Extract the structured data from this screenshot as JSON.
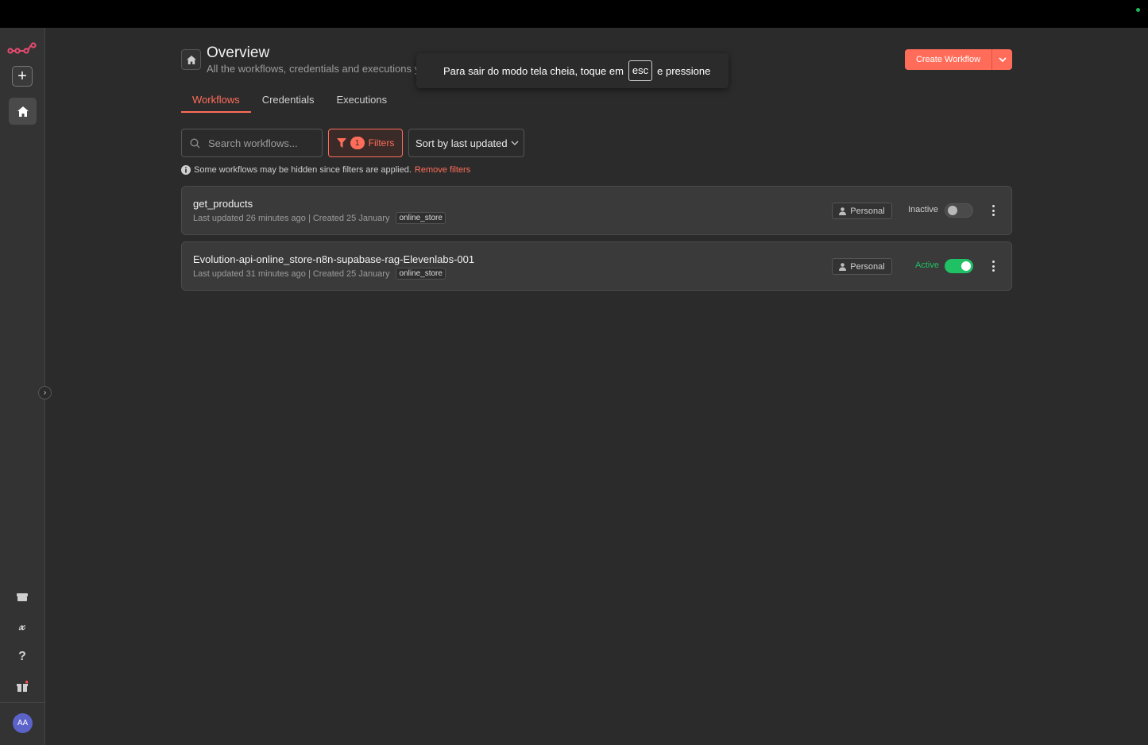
{
  "header": {
    "title": "Overview",
    "subtitle": "All the workflows, credentials and executions you h",
    "create_button": "Create Workflow"
  },
  "fullscreen_toast": {
    "before": "Para sair do modo tela cheia, toque em",
    "key": "esc",
    "after": "e pressione"
  },
  "tabs": [
    {
      "label": "Workflows",
      "active": true
    },
    {
      "label": "Credentials",
      "active": false
    },
    {
      "label": "Executions",
      "active": false
    }
  ],
  "toolbar": {
    "search_placeholder": "Search workflows...",
    "filters_count": "1",
    "filters_label": "Filters",
    "sort_label": "Sort by last updated"
  },
  "notice": {
    "text": "Some workflows may be hidden since filters are applied.",
    "link": "Remove filters"
  },
  "workflows": [
    {
      "name": "get_products",
      "meta": "Last updated 26 minutes ago | Created 25 January",
      "tag": "online_store",
      "owner": "Personal",
      "status": "Inactive",
      "active": false
    },
    {
      "name": "Evolution-api-online_store-n8n-supabase-rag-Elevenlabs-001",
      "meta": "Last updated 31 minutes ago | Created 25 January",
      "tag": "online_store",
      "owner": "Personal",
      "status": "Active",
      "active": true
    }
  ],
  "sidebar": {
    "avatar_initials": "AA"
  },
  "colors": {
    "accent": "#ff6d5a",
    "active_green": "#20c065",
    "background": "#2b2b2b"
  }
}
